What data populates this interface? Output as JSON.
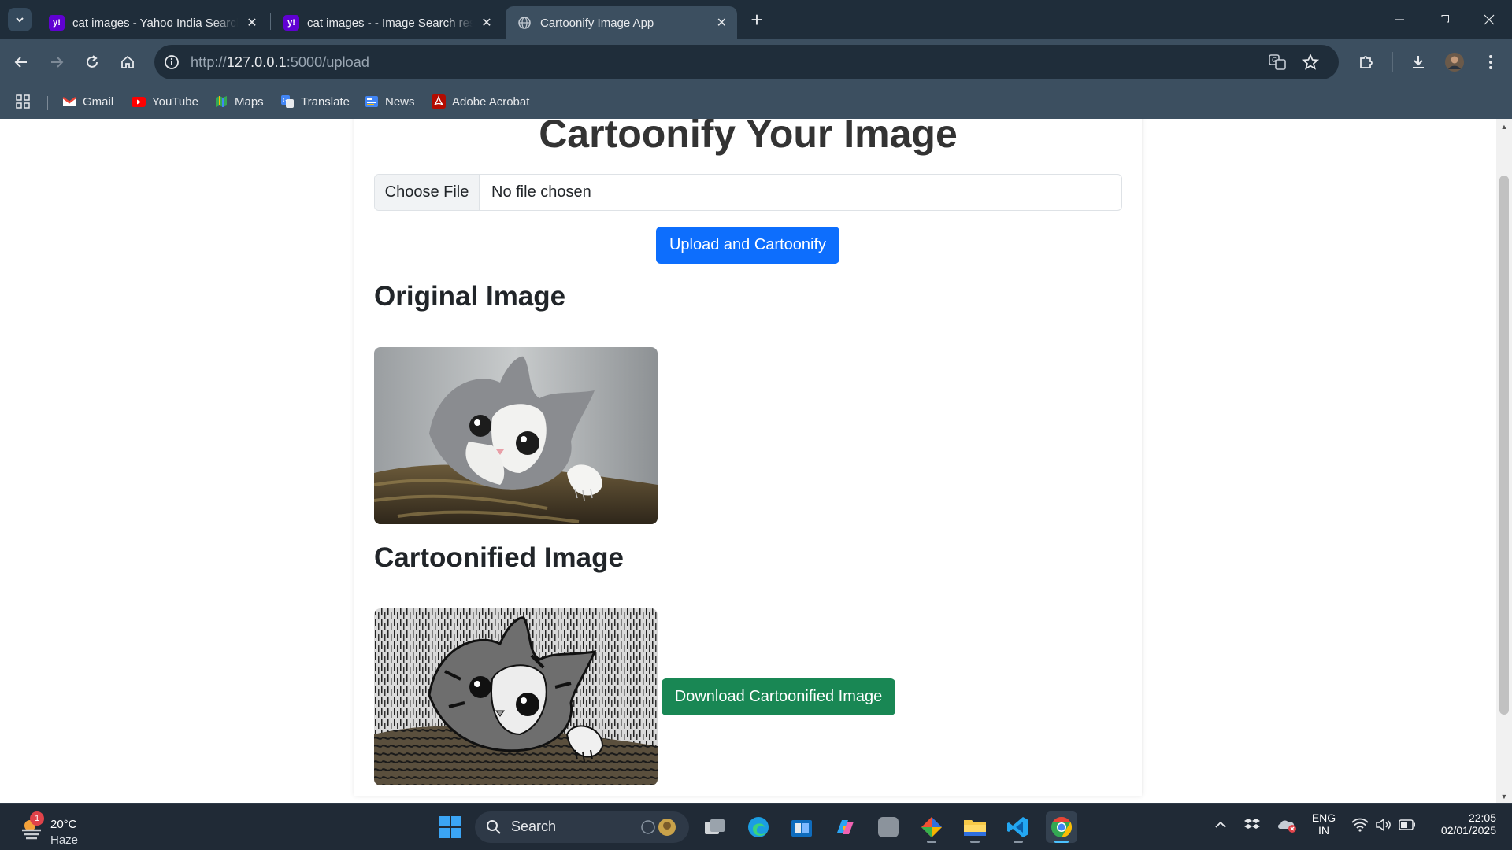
{
  "browser": {
    "tabs": [
      {
        "title": "cat images - Yahoo India Search Results",
        "favicon": "yahoo-icon",
        "active": false
      },
      {
        "title": "cat images - - Image Search results",
        "favicon": "yahoo-icon",
        "active": false
      },
      {
        "title": "Cartoonify Image App",
        "favicon": "globe-icon",
        "active": true
      }
    ],
    "url_protocol": "http://",
    "url_host": "127.0.0.1",
    "url_path": ":5000/upload",
    "bookmarks": [
      {
        "label": "Gmail",
        "icon": "gmail-icon"
      },
      {
        "label": "YouTube",
        "icon": "youtube-icon"
      },
      {
        "label": "Maps",
        "icon": "maps-icon"
      },
      {
        "label": "Translate",
        "icon": "translate-icon"
      },
      {
        "label": "News",
        "icon": "news-icon"
      },
      {
        "label": "Adobe Acrobat",
        "icon": "acrobat-icon"
      }
    ]
  },
  "page": {
    "title": "Cartoonify Your Image",
    "file_input": {
      "button_label": "Choose File",
      "status": "No file chosen"
    },
    "upload_button": "Upload and Cartoonify",
    "original_heading": "Original Image",
    "cartoon_heading": "Cartoonified Image",
    "download_button": "Download Cartoonified Image"
  },
  "taskbar": {
    "weather": {
      "badge": "1",
      "temp": "20°C",
      "condition": "Haze"
    },
    "search_label": "Search",
    "language": {
      "line1": "ENG",
      "line2": "IN"
    },
    "time": "22:05",
    "date": "02/01/2025"
  },
  "colors": {
    "primary_button": "#0d6efd",
    "success_button": "#198754",
    "chrome_frame": "#1f2d3a",
    "chrome_toolbar": "#3c4f60"
  }
}
